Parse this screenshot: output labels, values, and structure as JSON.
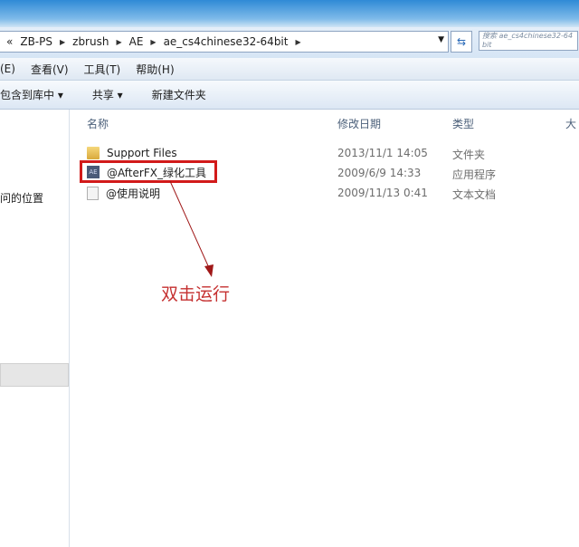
{
  "address": {
    "crumbs": [
      "«",
      "ZB-PS",
      "zbrush",
      "AE",
      "ae_cs4chinese32-64bit"
    ],
    "search_placeholder": "搜索 ae_cs4chinese32-64bit"
  },
  "menu": [
    "(E)",
    "查看(V)",
    "工具(T)",
    "帮助(H)"
  ],
  "toolbar": {
    "include": "包含到库中 ▾",
    "share": "共享 ▾",
    "new_folder": "新建文件夹"
  },
  "nav": {
    "item": "问的位置"
  },
  "columns": {
    "name": "名称",
    "date": "修改日期",
    "type": "类型",
    "size": "大"
  },
  "files": [
    {
      "name": "Support Files",
      "date": "2013/11/1 14:05",
      "type": "文件夹",
      "icon": "folder-icon"
    },
    {
      "name": "@AfterFX_绿化工具",
      "date": "2009/6/9 14:33",
      "type": "应用程序",
      "icon": "ae-app-icon"
    },
    {
      "name": "@使用说明",
      "date": "2009/11/13 0:41",
      "type": "文本文档",
      "icon": "text-file-icon"
    }
  ],
  "annotation": {
    "text": "双击运行",
    "color": "#c53030"
  }
}
